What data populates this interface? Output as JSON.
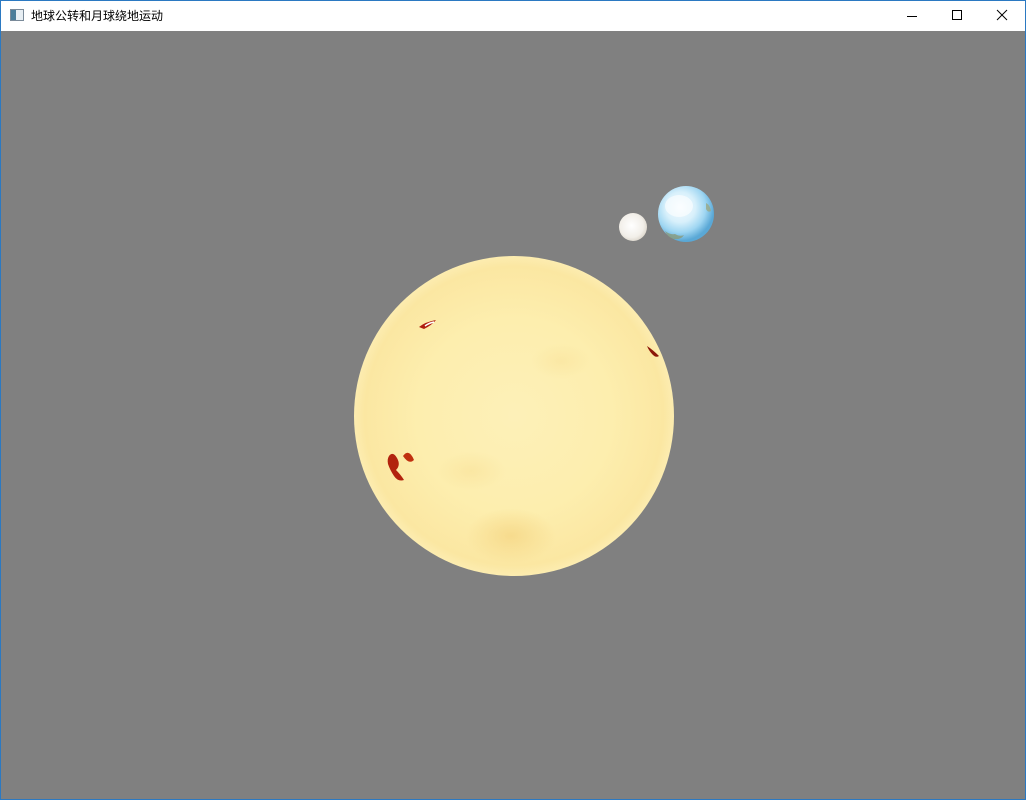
{
  "window": {
    "title": "地球公转和月球绕地运动"
  },
  "controls": {
    "minimize_icon": "minimize-icon",
    "maximize_icon": "maximize-icon",
    "close_icon": "close-icon"
  },
  "scene": {
    "background_color": "#808080",
    "sun_color": "#fdeeae",
    "earth_color": "#bfe6f7",
    "moon_color": "#f4f2ee"
  }
}
